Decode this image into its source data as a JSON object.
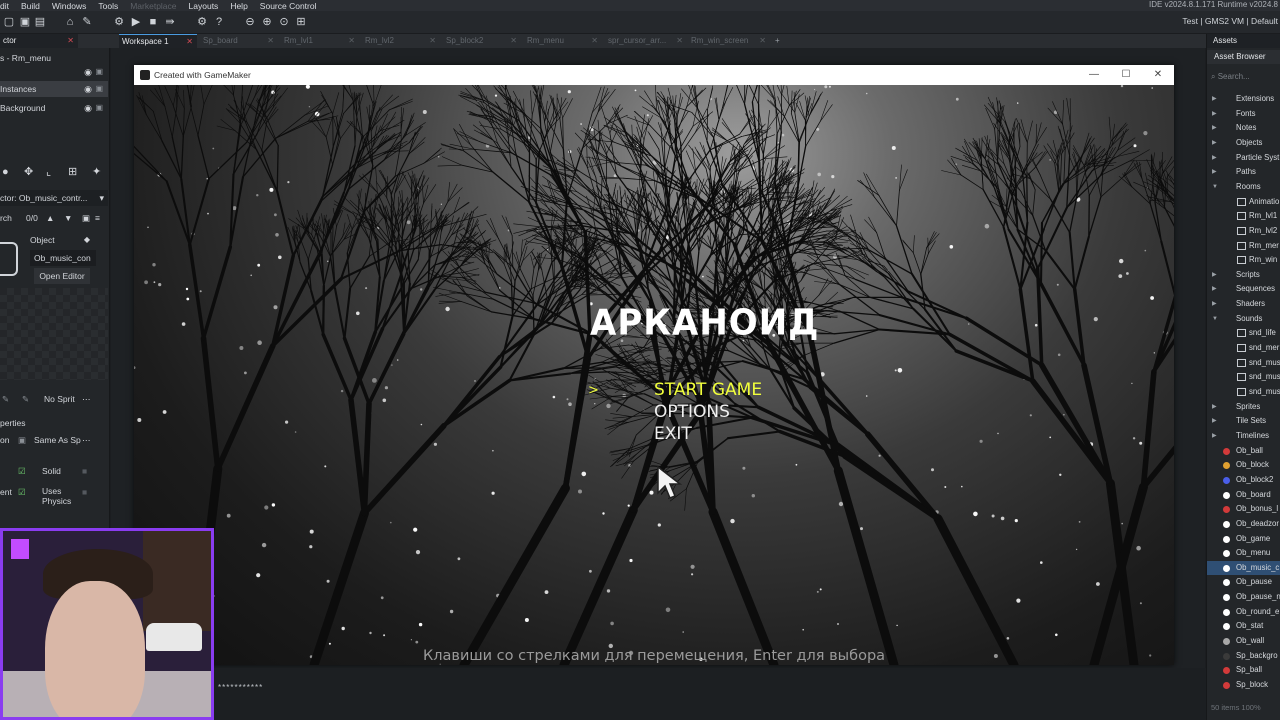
{
  "menubar": {
    "items": [
      "dit",
      "Build",
      "Windows",
      "Tools",
      "Marketplace",
      "Layouts",
      "Help",
      "Source Control"
    ],
    "ide_version": "IDE v2024.8.1.171  Runtime v2024.8"
  },
  "toolbar": {
    "right_text": "Test | GMS2 VM | Default"
  },
  "tabs": [
    {
      "label": "Workspace 1",
      "active": true
    },
    {
      "label": "Sp_board",
      "active": false
    },
    {
      "label": "Rm_lvl1",
      "active": false
    },
    {
      "label": "Rm_lvl2",
      "active": false
    },
    {
      "label": "Sp_block2",
      "active": false
    },
    {
      "label": "Rm_menu",
      "active": false
    },
    {
      "label": "spr_cursor_arr...",
      "active": false
    },
    {
      "label": "Rm_win_screen",
      "active": false
    }
  ],
  "left_panel": {
    "header": "ctor",
    "room_label": "s - Rm_menu",
    "layers": [
      "Instances",
      "Background"
    ],
    "inspector_label": "ctor: Ob_music_contr...",
    "search_label": "rch",
    "counter": "0/0",
    "object_header": "Object",
    "object_name": "Ob_music_con",
    "open_editor": "Open Editor",
    "no_sprite": "No Sprit",
    "properties": "perties",
    "collision_label": "on",
    "collision_value": "Same As Sp",
    "solid": "Solid",
    "physics_label": "ent",
    "uses_physics": "Uses Physics"
  },
  "game_window": {
    "title": "Created with GameMaker",
    "game_title": "АРКАНОИД",
    "menu_options": [
      "START GAME",
      "OPTIONS",
      "EXIT"
    ],
    "selected_index": 0,
    "selector_glyph": ">",
    "hint": "Клавиши со стрелками для перемещения, Enter для выбора"
  },
  "asset_browser": {
    "tab": "Assets",
    "header": "Asset Browser",
    "search_placeholder": "Search...",
    "tree": [
      {
        "label": "Extensions",
        "type": "folder"
      },
      {
        "label": "Fonts",
        "type": "folder"
      },
      {
        "label": "Notes",
        "type": "folder"
      },
      {
        "label": "Objects",
        "type": "folder"
      },
      {
        "label": "Particle Syst",
        "type": "folder"
      },
      {
        "label": "Paths",
        "type": "folder"
      },
      {
        "label": "Rooms",
        "type": "folder-open"
      },
      {
        "label": "Animatio",
        "type": "child"
      },
      {
        "label": "Rm_lvl1",
        "type": "child"
      },
      {
        "label": "Rm_lvl2",
        "type": "child"
      },
      {
        "label": "Rm_mer",
        "type": "child"
      },
      {
        "label": "Rm_win",
        "type": "child"
      },
      {
        "label": "Scripts",
        "type": "folder"
      },
      {
        "label": "Sequences",
        "type": "folder"
      },
      {
        "label": "Shaders",
        "type": "folder"
      },
      {
        "label": "Sounds",
        "type": "folder-open"
      },
      {
        "label": "snd_life",
        "type": "child"
      },
      {
        "label": "snd_mer",
        "type": "child"
      },
      {
        "label": "snd_mus",
        "type": "child"
      },
      {
        "label": "snd_mus",
        "type": "child"
      },
      {
        "label": "snd_mus",
        "type": "child"
      },
      {
        "label": "Sprites",
        "type": "folder"
      },
      {
        "label": "Tile Sets",
        "type": "folder"
      },
      {
        "label": "Timelines",
        "type": "folder"
      },
      {
        "label": "Ob_ball",
        "type": "object",
        "color": "#d23a3a"
      },
      {
        "label": "Ob_block",
        "type": "object",
        "color": "#e0a030"
      },
      {
        "label": "Ob_block2",
        "type": "object",
        "color": "#4a5ee8"
      },
      {
        "label": "Ob_board",
        "type": "object",
        "color": "#ffffff"
      },
      {
        "label": "Ob_bonus_l",
        "type": "object",
        "color": "#d23a3a"
      },
      {
        "label": "Ob_deadzor",
        "type": "object",
        "color": "#ffffff"
      },
      {
        "label": "Ob_game",
        "type": "object",
        "color": "#ffffff"
      },
      {
        "label": "Ob_menu",
        "type": "object",
        "color": "#ffffff"
      },
      {
        "label": "Ob_music_c",
        "type": "object",
        "color": "#ffffff"
      },
      {
        "label": "Ob_pause",
        "type": "object",
        "color": "#ffffff"
      },
      {
        "label": "Ob_pause_n",
        "type": "object",
        "color": "#ffffff"
      },
      {
        "label": "Ob_round_e",
        "type": "object",
        "color": "#ffffff"
      },
      {
        "label": "Ob_stat",
        "type": "object",
        "color": "#ffffff"
      },
      {
        "label": "Ob_wall",
        "type": "object",
        "color": "#a8a8a8"
      },
      {
        "label": "Sp_backgro",
        "type": "object",
        "color": "#3a3a3a"
      },
      {
        "label": "Sp_ball",
        "type": "object",
        "color": "#d23a3a"
      },
      {
        "label": "Sp_block",
        "type": "object",
        "color": "#d23a3a"
      }
    ],
    "selected": "Ob_music_c",
    "footer": "50 items 100%"
  },
  "output": {
    "masked_text": "***********"
  }
}
